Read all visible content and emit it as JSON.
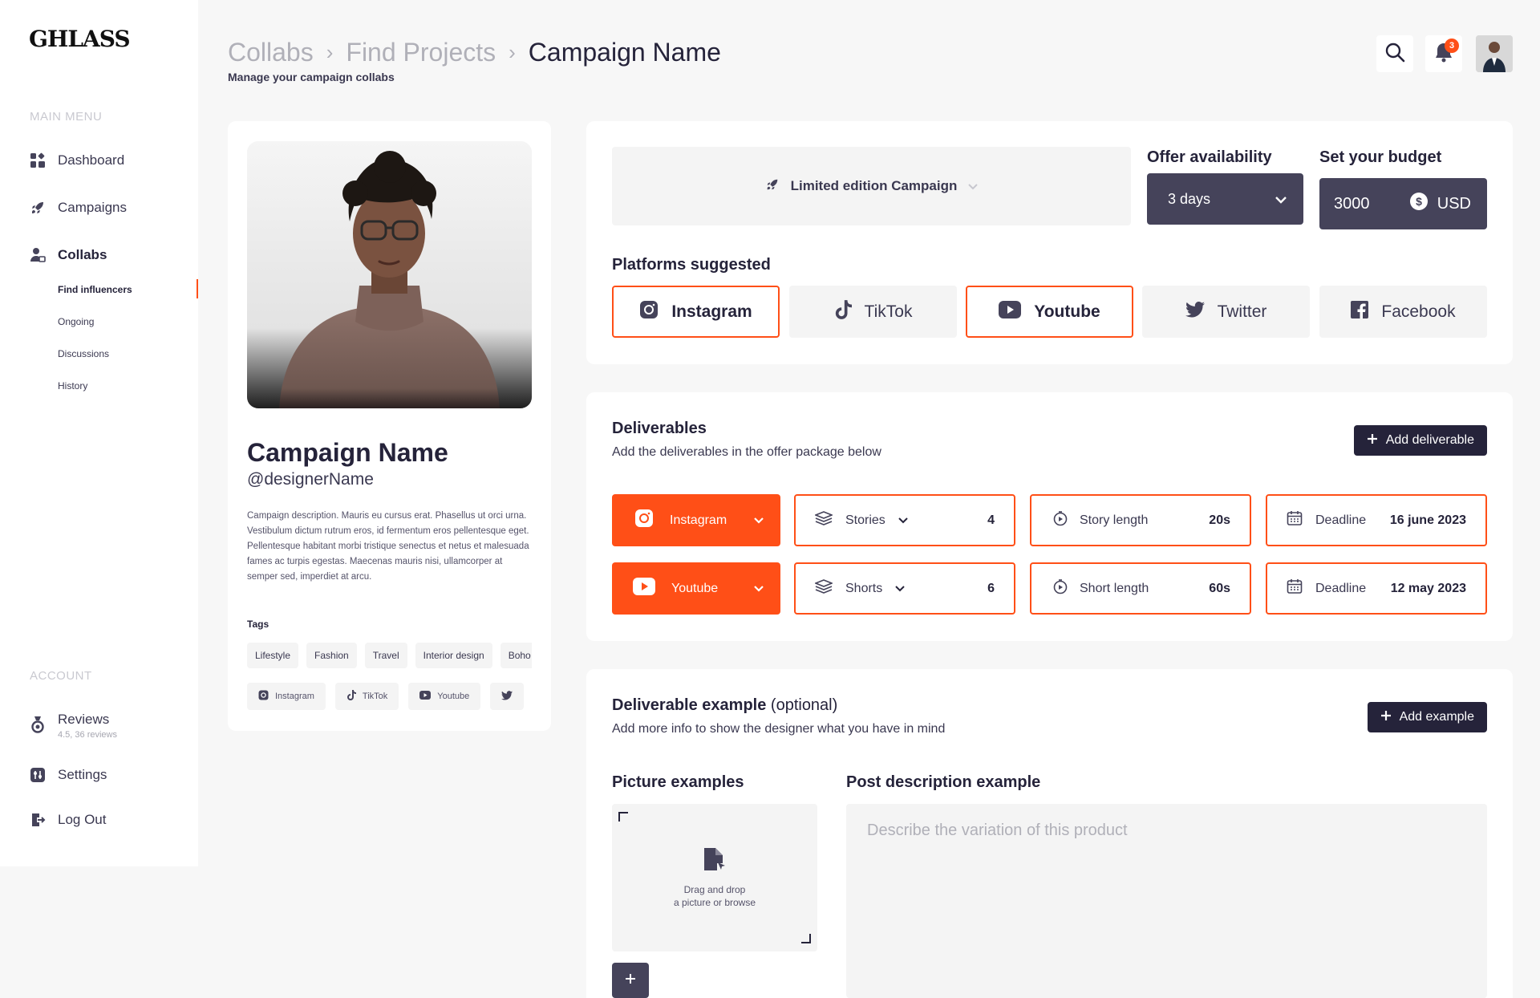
{
  "app": {
    "logo": "GHLASS"
  },
  "sidebar": {
    "main_heading": "MAIN MENU",
    "items": [
      {
        "label": "Dashboard",
        "icon": "dashboard-icon"
      },
      {
        "label": "Campaigns",
        "icon": "rocket-icon"
      },
      {
        "label": "Collabs",
        "icon": "collabs-icon"
      }
    ],
    "sub_items": [
      {
        "label": "Find influencers"
      },
      {
        "label": "Ongoing"
      },
      {
        "label": "Discussions"
      },
      {
        "label": "History"
      }
    ],
    "account_heading": "ACCOUNT",
    "reviews": {
      "label": "Reviews",
      "sub": "4.5, 36 reviews"
    },
    "settings": "Settings",
    "logout": "Log Out"
  },
  "header": {
    "breadcrumb": [
      "Collabs",
      "Find Projects",
      "Campaign Name"
    ],
    "subtitle": "Manage your campaign collabs",
    "notification_count": "3"
  },
  "profile": {
    "title": "Campaign Name",
    "handle": "@designerName",
    "description": "Campaign description. Mauris eu cursus erat. Phasellus ut orci urna. Vestibulum dictum rutrum eros, id fermentum eros pellentesque eget. Pellentesque habitant morbi tristique senectus et netus et malesuada fames ac turpis egestas. Maecenas mauris nisi, ullamcorper at semper sed, imperdiet at arcu.",
    "tags_label": "Tags",
    "tags": [
      "Lifestyle",
      "Fashion",
      "Travel",
      "Interior design",
      "Boho"
    ],
    "platforms": [
      "Instagram",
      "TikTok",
      "Youtube"
    ]
  },
  "offer": {
    "campaign_select": "Limited edition Campaign",
    "availability_label": "Offer availability",
    "availability_value": "3 days",
    "budget_label": "Set your budget",
    "budget_value": "3000",
    "budget_currency": "USD",
    "platforms_label": "Platforms suggested",
    "platforms": [
      {
        "label": "Instagram",
        "selected": true
      },
      {
        "label": "TikTok",
        "selected": false
      },
      {
        "label": "Youtube",
        "selected": true
      },
      {
        "label": "Twitter",
        "selected": false
      },
      {
        "label": "Facebook",
        "selected": false
      }
    ]
  },
  "deliverables": {
    "title": "Deliverables",
    "subtitle": "Add the deliverables in the offer package below",
    "add_label": "Add deliverable",
    "rows": [
      {
        "platform": "Instagram",
        "type": "Stories",
        "count": "4",
        "length_label": "Story length",
        "length_value": "20s",
        "deadline_label": "Deadline",
        "deadline_value": "16 june 2023"
      },
      {
        "platform": "Youtube",
        "type": "Shorts",
        "count": "6",
        "length_label": "Short length",
        "length_value": "60s",
        "deadline_label": "Deadline",
        "deadline_value": "12 may 2023"
      }
    ]
  },
  "example": {
    "title": "Deliverable example",
    "optional": "(optional)",
    "subtitle": "Add more info to show the designer what you have in mind",
    "add_label": "Add example",
    "pictures_label": "Picture examples",
    "dropzone_line1": "Drag and drop",
    "dropzone_line2": "a picture or browse",
    "post_label": "Post description example",
    "post_placeholder": "Describe the variation of this product"
  },
  "colors": {
    "accent": "#ff4f17",
    "dark": "#25233a",
    "dark_control": "#45435a",
    "surface": "#f4f4f4"
  }
}
